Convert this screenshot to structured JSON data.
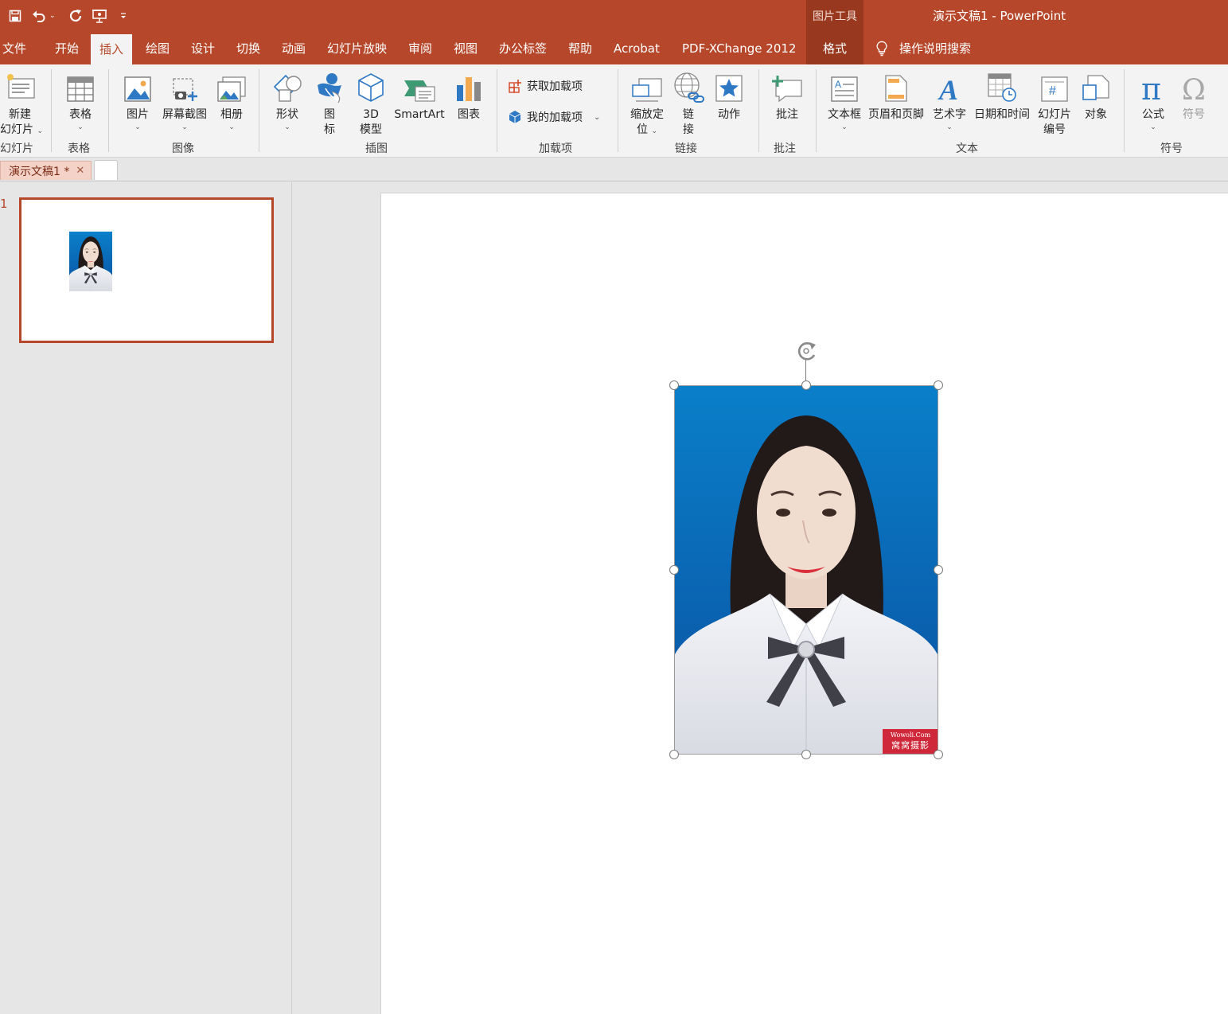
{
  "window": {
    "app_title": "演示文稿1  -  PowerPoint",
    "context_group": "图片工具"
  },
  "quick_access": [
    "save-icon",
    "undo-icon",
    "redo-icon",
    "present-from-start-icon",
    "customize-icon"
  ],
  "ribbon_tabs": [
    "文件",
    "开始",
    "插入",
    "绘图",
    "设计",
    "切换",
    "动画",
    "幻灯片放映",
    "审阅",
    "视图",
    "办公标签",
    "帮助",
    "Acrobat",
    "PDF-XChange 2012",
    "格式"
  ],
  "active_tab": "插入",
  "tell_me": "操作说明搜索",
  "ribbon": {
    "slides": {
      "new_slide_1": "新建",
      "new_slide_2": "幻灯片",
      "group": "幻灯片"
    },
    "tables": {
      "table": "表格",
      "group": "表格"
    },
    "images": {
      "picture": "图片",
      "screenshot": "屏幕截图",
      "album": "相册",
      "group": "图像"
    },
    "illustrations": {
      "shapes": "形状",
      "icons_1": "图",
      "icons_2": "标",
      "model_1": "3D",
      "model_2": "模型",
      "smartart": "SmartArt",
      "chart": "图表",
      "group": "插图"
    },
    "addins": {
      "get": "获取加载项",
      "mine": "我的加载项",
      "group": "加载项"
    },
    "links": {
      "zoom_1": "缩放定",
      "zoom_2": "位",
      "link_1": "链",
      "link_2": "接",
      "action": "动作",
      "group": "链接"
    },
    "comments": {
      "comment": "批注",
      "group": "批注"
    },
    "text": {
      "textbox": "文本框",
      "header_footer": "页眉和页脚",
      "wordart": "艺术字",
      "datetime": "日期和时间",
      "slide_number_1": "幻灯片",
      "slide_number_2": "编号",
      "object": "对象",
      "group": "文本"
    },
    "symbols": {
      "equation": "公式",
      "symbol": "符号",
      "group": "符号"
    }
  },
  "document_tab": {
    "name": "演示文稿1 *"
  },
  "thumbnails": [
    {
      "number": "1"
    }
  ],
  "watermark": {
    "line1": "Wowoli.Com",
    "line2": "窝窝摄影"
  },
  "colors": {
    "accent": "#b7472a",
    "context": "#98391f",
    "photo_bg": "#0a6ec0"
  }
}
